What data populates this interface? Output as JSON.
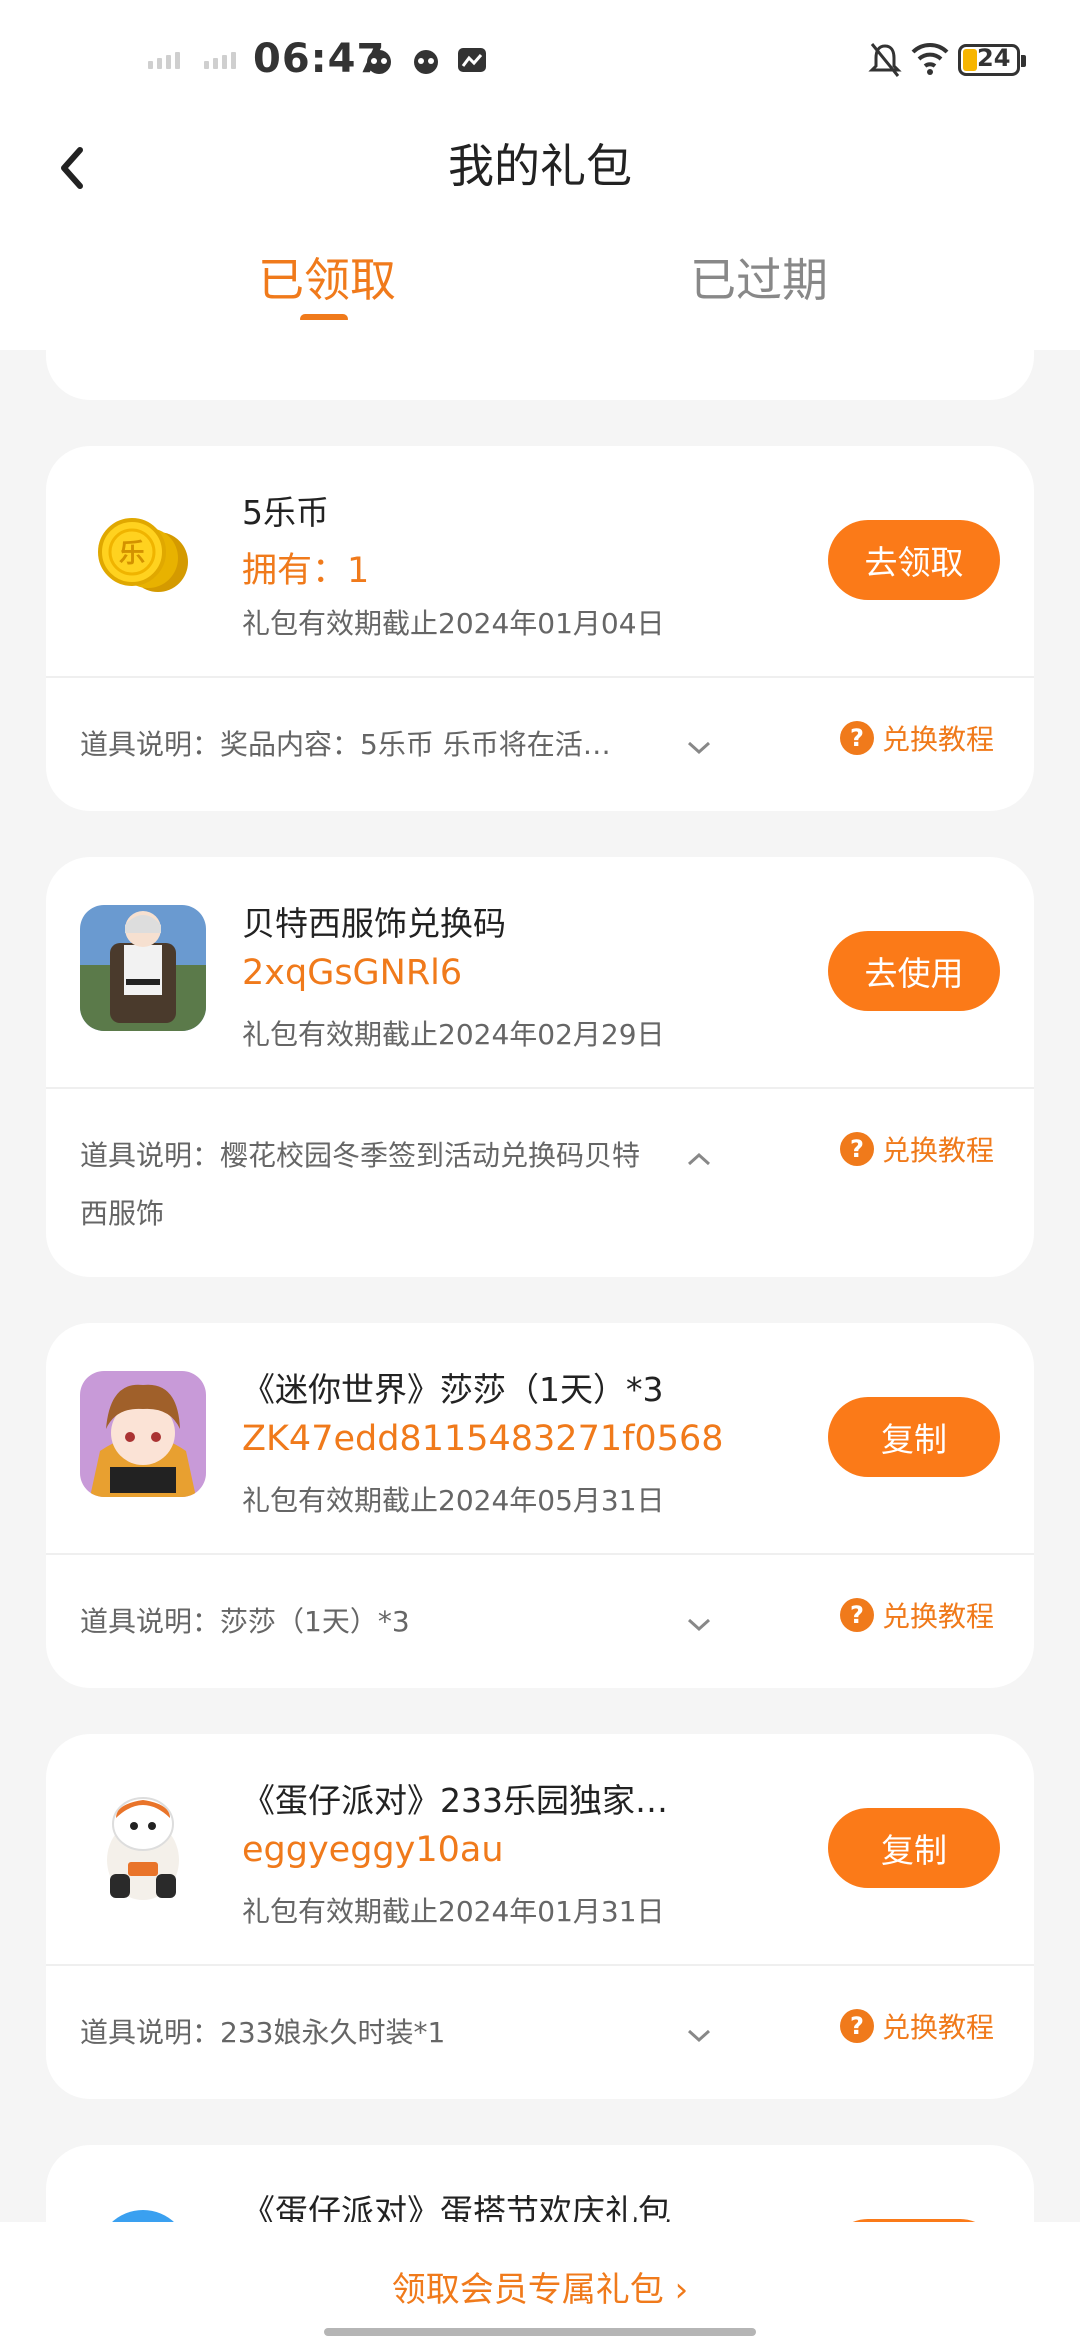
{
  "status_bar": {
    "time": "06:47",
    "battery": "24"
  },
  "header": {
    "title": "我的礼包",
    "tabs": [
      {
        "label": "已领取",
        "active": true
      },
      {
        "label": "已过期",
        "active": false
      }
    ]
  },
  "gifts": [
    {
      "name": "5乐币",
      "code": "拥有：1",
      "expire": "礼包有效期截止2024年01月04日",
      "button": "去领取",
      "desc": "道具说明：奖品内容：5乐币 乐币将在活…",
      "help": "兑换教程",
      "icon": "gold-coins-icon"
    },
    {
      "name": "贝特西服饰兑换码",
      "code": "2xqGsGNRl6",
      "expire": "礼包有效期截止2024年02月29日",
      "button": "去使用",
      "desc": "道具说明：樱花校园冬季签到活动兑换码贝特西服饰",
      "help": "兑换教程",
      "icon": "character-costume-icon"
    },
    {
      "name": "《迷你世界》莎莎（1天）*3",
      "code": "ZK47edd8115483271f0568",
      "expire": "礼包有效期截止2024年05月31日",
      "button": "复制",
      "desc": "道具说明：莎莎（1天）*3",
      "help": "兑换教程",
      "icon": "anime-girl-icon"
    },
    {
      "name": "《蛋仔派对》233乐园独家…",
      "code": "eggyeggy10au",
      "expire": "礼包有效期截止2024年01月31日",
      "button": "复制",
      "desc": "道具说明：233娘永久时装*1",
      "help": "兑换教程",
      "icon": "eggy-mascot-icon"
    },
    {
      "name": "《蛋仔派对》蛋搭节欢庆礼包",
      "icon": "blue-orb-icon"
    }
  ],
  "bottom": {
    "link": "领取会员专属礼包 ›"
  },
  "colors": {
    "accent": "#f07a1b",
    "button": "#fb7a18",
    "background": "#f5f5f5"
  }
}
